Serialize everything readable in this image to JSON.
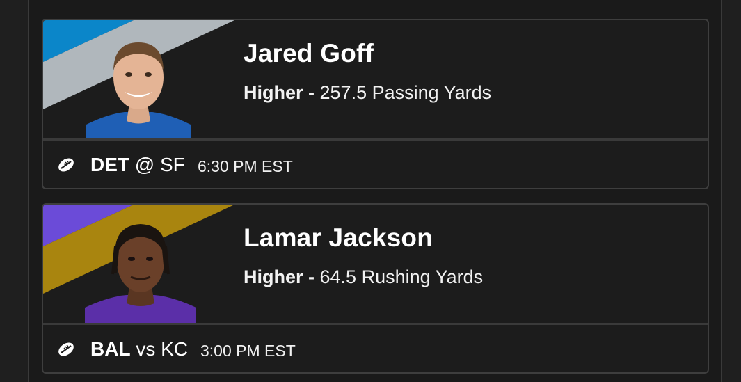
{
  "colors": {
    "detroit_primary": "#0b86c9",
    "detroit_secondary": "#b0b7bc",
    "baltimore_primary": "#6b4bd8",
    "baltimore_secondary": "#a9850f",
    "card_bg": "#1c1c1c",
    "card_border": "#3e3e3e"
  },
  "picks": [
    {
      "player_name": "Jared Goff",
      "direction": "Higher",
      "separator": " - ",
      "line": "257.5 Passing Yards",
      "sport_icon": "football-icon",
      "team": "DET",
      "connector": "@",
      "opponent": "SF",
      "game_time": "6:30 PM EST"
    },
    {
      "player_name": "Lamar Jackson",
      "direction": "Higher",
      "separator": " - ",
      "line": "64.5 Rushing Yards",
      "sport_icon": "football-icon",
      "team": "BAL",
      "connector": "vs",
      "opponent": "KC",
      "game_time": "3:00 PM EST"
    }
  ]
}
